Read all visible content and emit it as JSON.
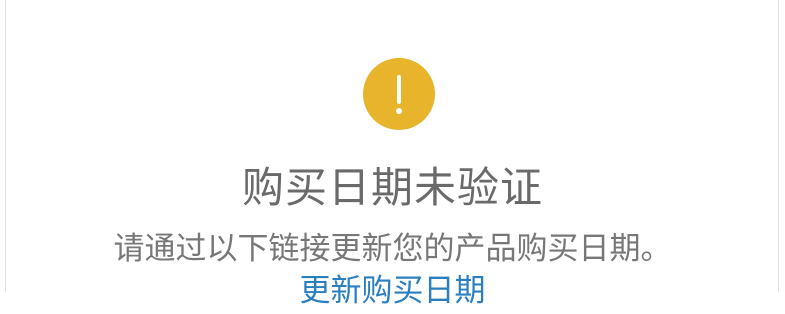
{
  "dialog": {
    "icon": "warning-exclamation-icon",
    "icon_color": "#e8b42c",
    "title": "购买日期未验证",
    "message": "请通过以下链接更新您的产品购买日期。",
    "link_label": "更新购买日期",
    "link_color": "#2a7fc0"
  }
}
